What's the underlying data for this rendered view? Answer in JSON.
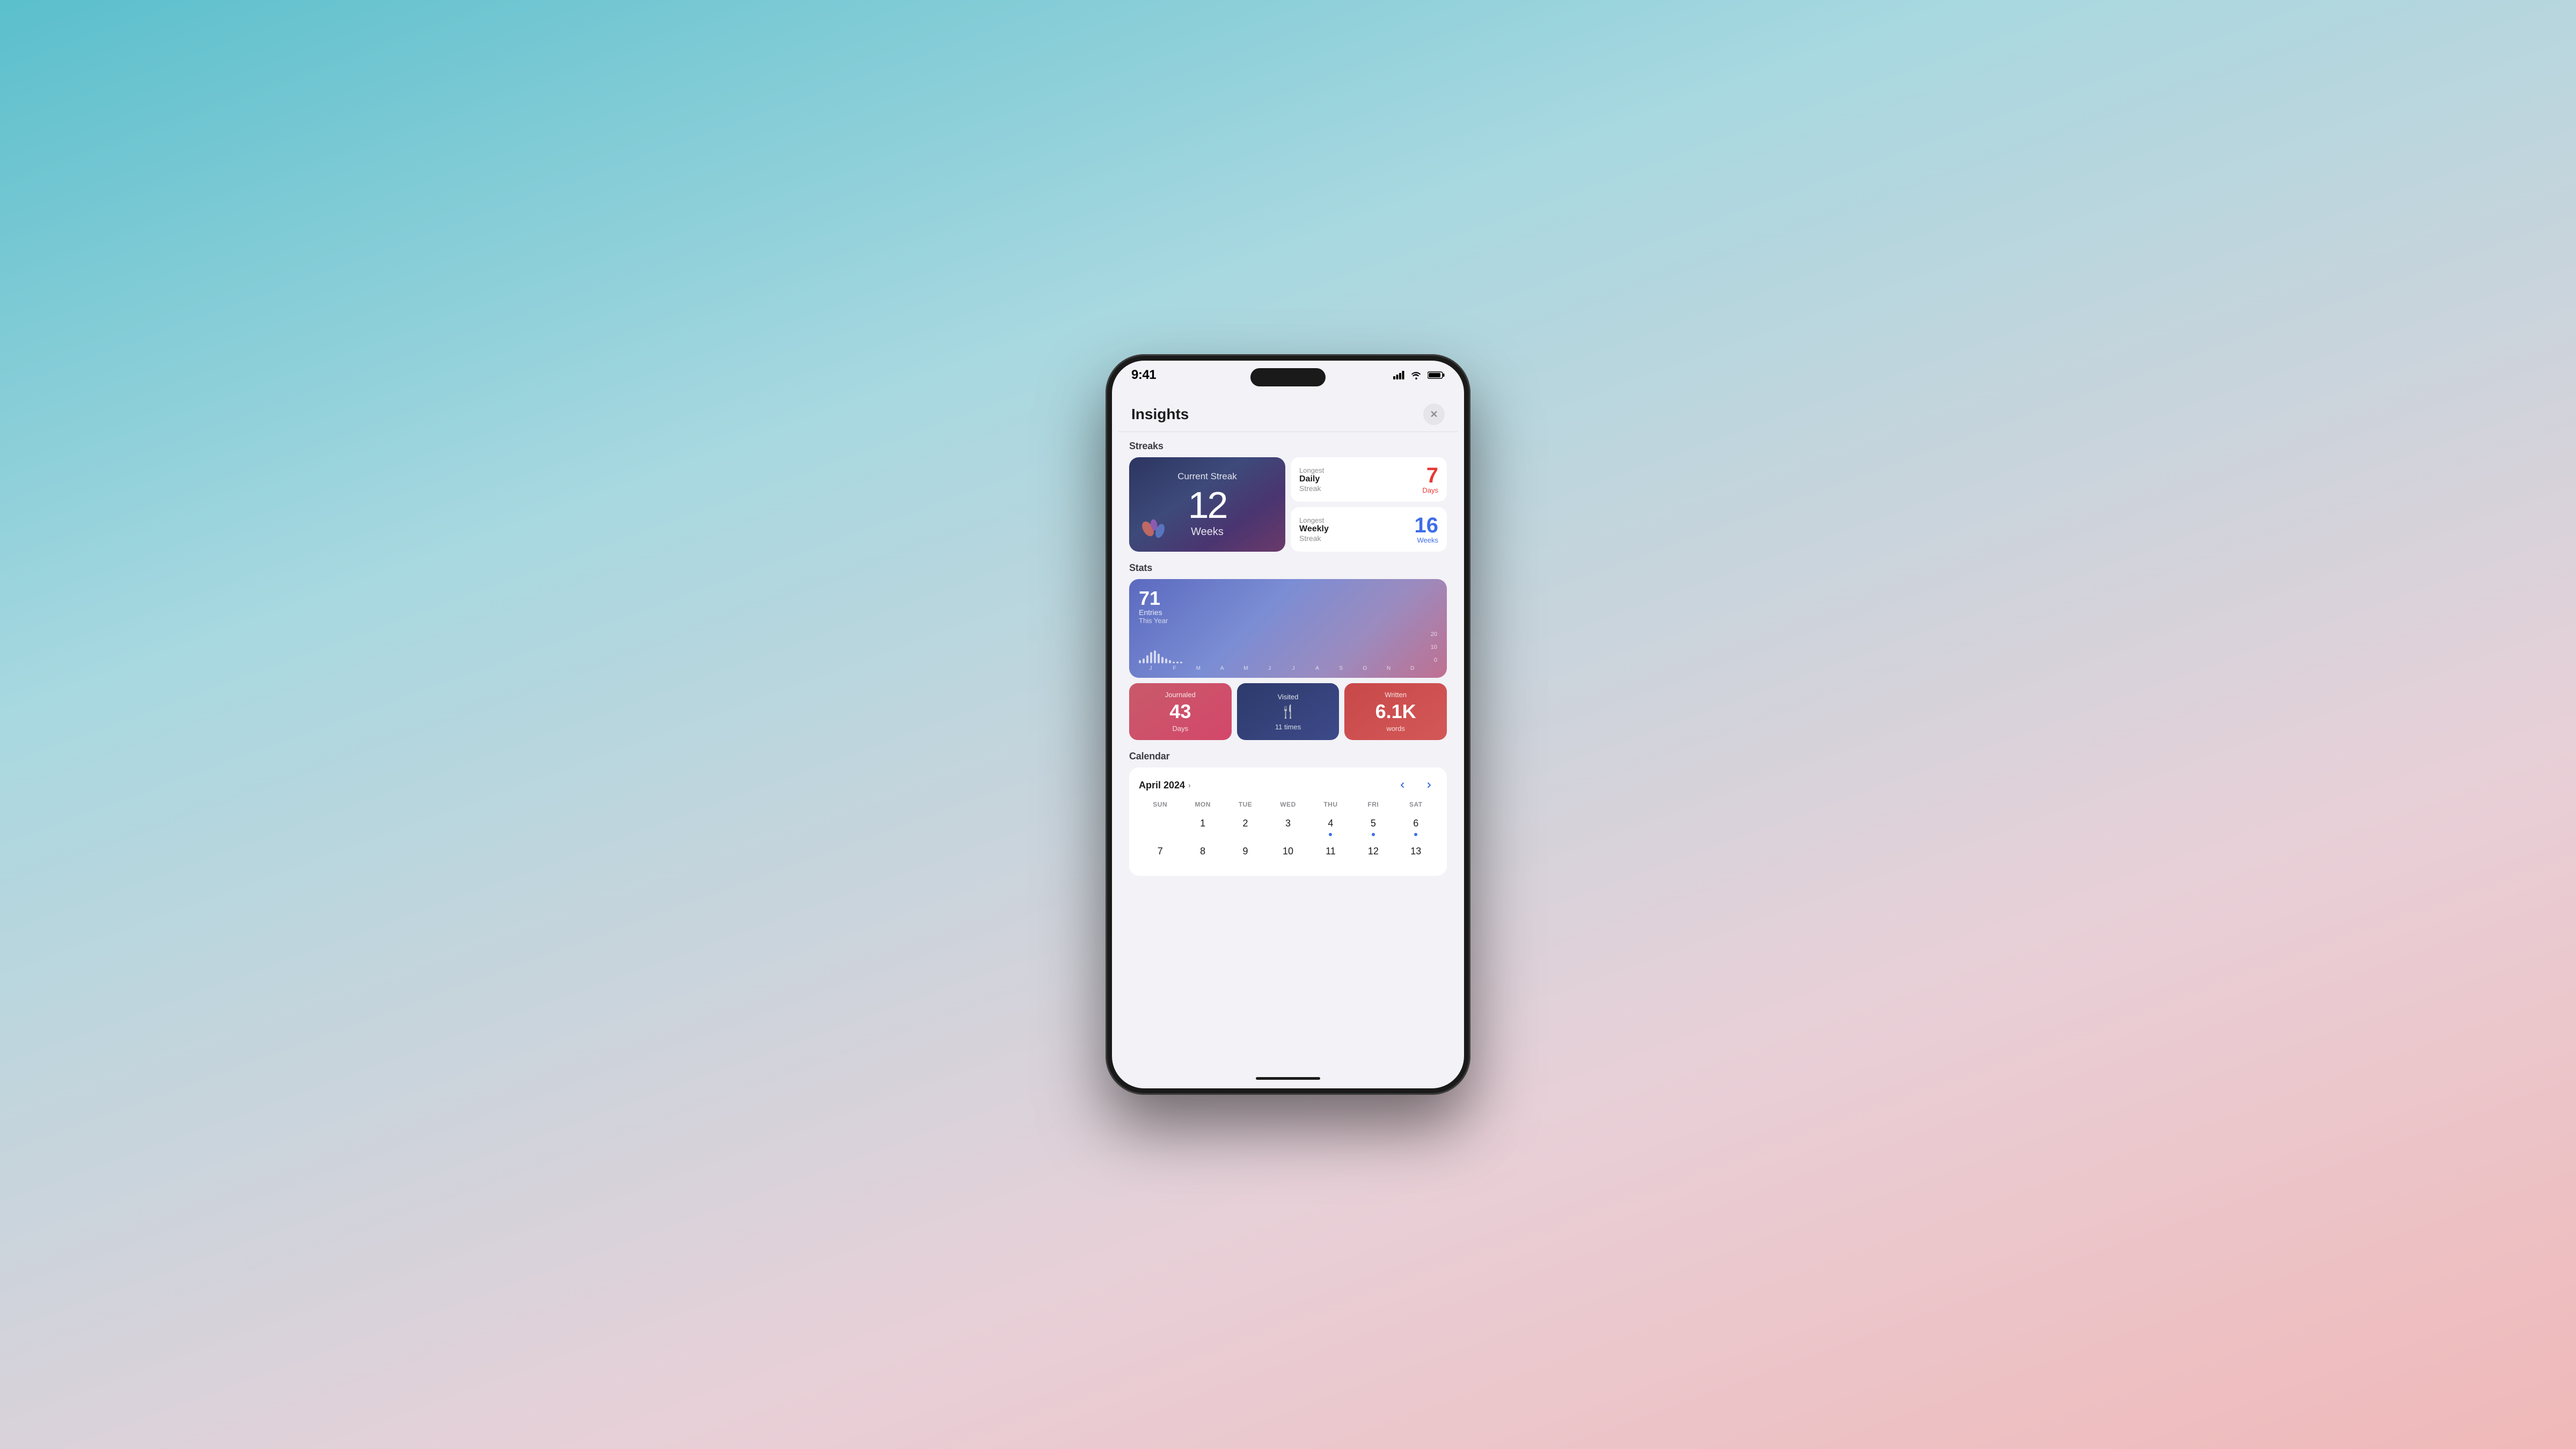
{
  "status_bar": {
    "time": "9:41"
  },
  "modal": {
    "title": "Insights",
    "close_label": "✕"
  },
  "streaks": {
    "section_label": "Streaks",
    "current": {
      "label": "Current Streak",
      "number": "12",
      "unit": "Weeks"
    },
    "longest_daily": {
      "top": "Longest",
      "bold": "Daily",
      "bottom": "Streak",
      "number": "7",
      "unit": "Days",
      "color": "red"
    },
    "longest_weekly": {
      "top": "Longest",
      "bold": "Weekly",
      "bottom": "Streak",
      "number": "16",
      "unit": "Weeks",
      "color": "blue"
    }
  },
  "stats": {
    "section_label": "Stats",
    "entries": {
      "number": "71",
      "label": "Entries",
      "sublabel": "This Year"
    },
    "chart": {
      "y_max": "20",
      "y_mid": "10",
      "y_min": "0",
      "months": [
        "J",
        "F",
        "M",
        "A",
        "M",
        "J",
        "J",
        "A",
        "S",
        "O",
        "N",
        "D"
      ],
      "bars": [
        2,
        3,
        5,
        7,
        8,
        6,
        4,
        3,
        2,
        1,
        1,
        1
      ]
    },
    "journaled": {
      "label": "Journaled",
      "number": "43",
      "sublabel": "Days"
    },
    "visited": {
      "label": "Visited",
      "sublabel": "11 times"
    },
    "written": {
      "label": "Written",
      "number": "6.1K",
      "sublabel": "words"
    }
  },
  "calendar": {
    "section_label": "Calendar",
    "month_year": "April 2024",
    "month_link_arrow": "›",
    "days_of_week": [
      "SUN",
      "MON",
      "TUE",
      "WED",
      "THU",
      "FRI",
      "SAT"
    ],
    "days": [
      {
        "num": "",
        "dot": false
      },
      {
        "num": "1",
        "dot": false
      },
      {
        "num": "2",
        "dot": false
      },
      {
        "num": "3",
        "dot": false
      },
      {
        "num": "4",
        "dot": true
      },
      {
        "num": "5",
        "dot": true
      },
      {
        "num": "6",
        "dot": true
      },
      {
        "num": "7",
        "dot": false
      },
      {
        "num": "8",
        "dot": false
      },
      {
        "num": "9",
        "dot": false
      },
      {
        "num": "10",
        "dot": false
      },
      {
        "num": "11",
        "dot": false
      },
      {
        "num": "12",
        "dot": false
      },
      {
        "num": "13",
        "dot": false
      }
    ]
  }
}
